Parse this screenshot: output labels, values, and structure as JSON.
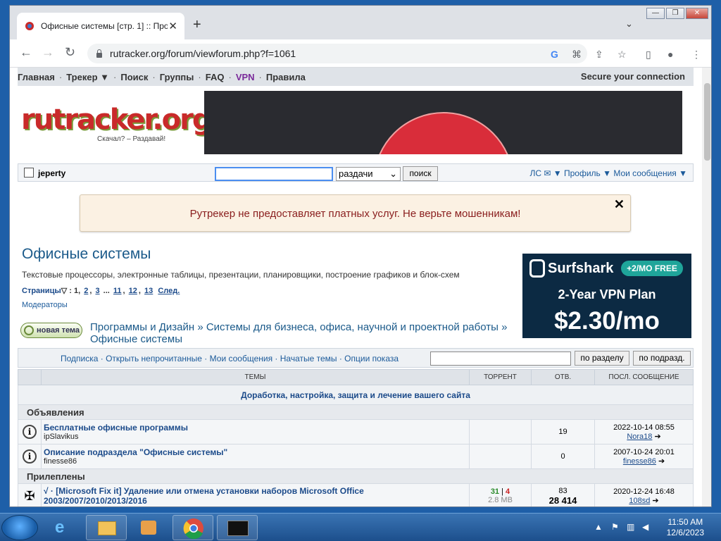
{
  "browser": {
    "tab_title": "Офисные системы [стр. 1] :: Про",
    "tab_close": "✕",
    "new_tab": "+",
    "tab_dropdown": "⌄",
    "url": "rutracker.org/forum/viewforum.php?f=1061",
    "window_min": "—",
    "window_max": "❐",
    "window_close": "✕"
  },
  "topnav": {
    "items": [
      "Главная",
      "Трекер ▼",
      "Поиск",
      "Группы",
      "FAQ",
      "VPN",
      "Правила"
    ],
    "secure": "Secure your connection"
  },
  "logo": {
    "main": "rutracker.org",
    "tagline": "Скачал? – Раздавай!"
  },
  "userbar": {
    "username": "jeperty",
    "search_scope": "раздачи",
    "search_button": "поиск",
    "links": "ЛС ✉ ▼   Профиль ▼   Мои сообщения ▼"
  },
  "warning": {
    "text": "Рутрекер не предоставляет платных услуг. Не верьте мошенникам!",
    "close": "✕"
  },
  "forum": {
    "title": "Офисные системы",
    "description": "Текстовые процессоры, электронные таблицы, презентации, планировщики, построение графиков и блок-схем",
    "pages_label": "Страницы",
    "pages": [
      "1",
      "2",
      "3",
      "...",
      "11",
      "12",
      "13",
      "След."
    ],
    "moderators": "Модераторы",
    "new_topic": "новая тема",
    "breadcrumb": "Программы и Дизайн » Системы для бизнеса, офиса, научной и проектной работы » Офисные системы"
  },
  "ad": {
    "brand": "Surfshark",
    "pill": "+2/MO FREE",
    "plan": "2-Year VPN Plan",
    "price": "$2.30/mo"
  },
  "filters": {
    "links": "Подписка · Открыть непрочитанные · Мои сообщения · Начатые темы · Опции показа",
    "btn_section": "по разделу",
    "btn_subsection": "по подразд."
  },
  "table": {
    "headers": [
      "ТЕМЫ",
      "ТОРРЕНТ",
      "ОТВ.",
      "ПОСЛ. СООБЩЕНИЕ"
    ],
    "subhead": "Доработка, настройка, защита и лечение вашего сайта",
    "section1": "Объявления",
    "section2": "Прилеплены",
    "rows": [
      {
        "title": "Бесплатные офисные программы",
        "author": "ipSlavikus",
        "replies": "19",
        "date": "2022-10-14 08:55",
        "user": "Nora18"
      },
      {
        "title": "Описание подраздела \"Офисные системы\"",
        "author": "finesse86",
        "replies": "0",
        "date": "2007-10-24 20:01",
        "user": "finesse86"
      },
      {
        "title": "√ · [Microsoft Fix it] Удаление или отмена установки наборов Microsoft Office 2003/2007/2010/2013/2016",
        "author": "",
        "seeds": "31",
        "leech": "4",
        "size": "2.8 MB",
        "replies": "83",
        "downloads": "28 414",
        "date": "2020-12-24 16:48",
        "user": "108sd"
      }
    ]
  },
  "taskbar": {
    "time": "11:50 AM",
    "date": "12/6/2023"
  }
}
